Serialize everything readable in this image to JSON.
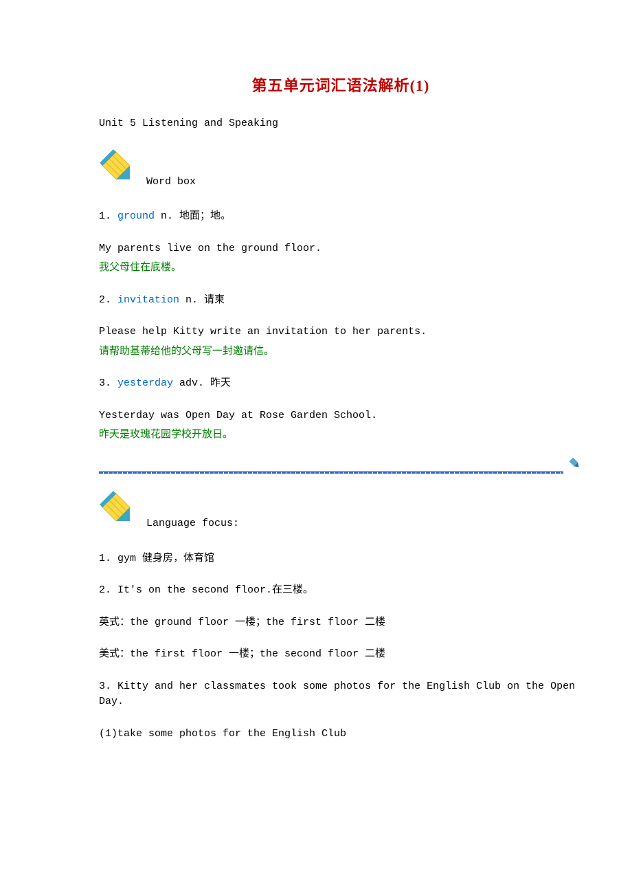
{
  "title": "第五单元词汇语法解析(1)",
  "subtitle": "Unit 5 Listening and Speaking",
  "section1_label": "Word box",
  "word1": {
    "num": "1. ",
    "word": "ground",
    "def": " n. 地面；地。",
    "example_en": "My parents live on the ground floor.",
    "example_cn": "我父母住在底楼。"
  },
  "word2": {
    "num": "2. ",
    "word": "invitation",
    "def": " n. 请柬",
    "example_en": "Please help Kitty write an invitation to her parents.",
    "example_cn": "请帮助基蒂给他的父母写一封邀请信。"
  },
  "word3": {
    "num": "3. ",
    "word": "yesterday",
    "def": " adv. 昨天",
    "example_en": "Yesterday was Open Day at Rose Garden School.",
    "example_cn": "昨天是玫瑰花园学校开放日。"
  },
  "section2_label": "Language focus:",
  "lf1": "1. gym 健身房，体育馆",
  "lf2": "2. It's on the second floor.在三楼。",
  "lf3": "英式：the ground floor 一楼；the first floor 二楼",
  "lf4": "美式：the first floor 一楼；the second floor 二楼",
  "lf5": "3. Kitty and her classmates took some photos for the English Club on the Open Day.",
  "lf6": "(1)take some photos for the English Club"
}
